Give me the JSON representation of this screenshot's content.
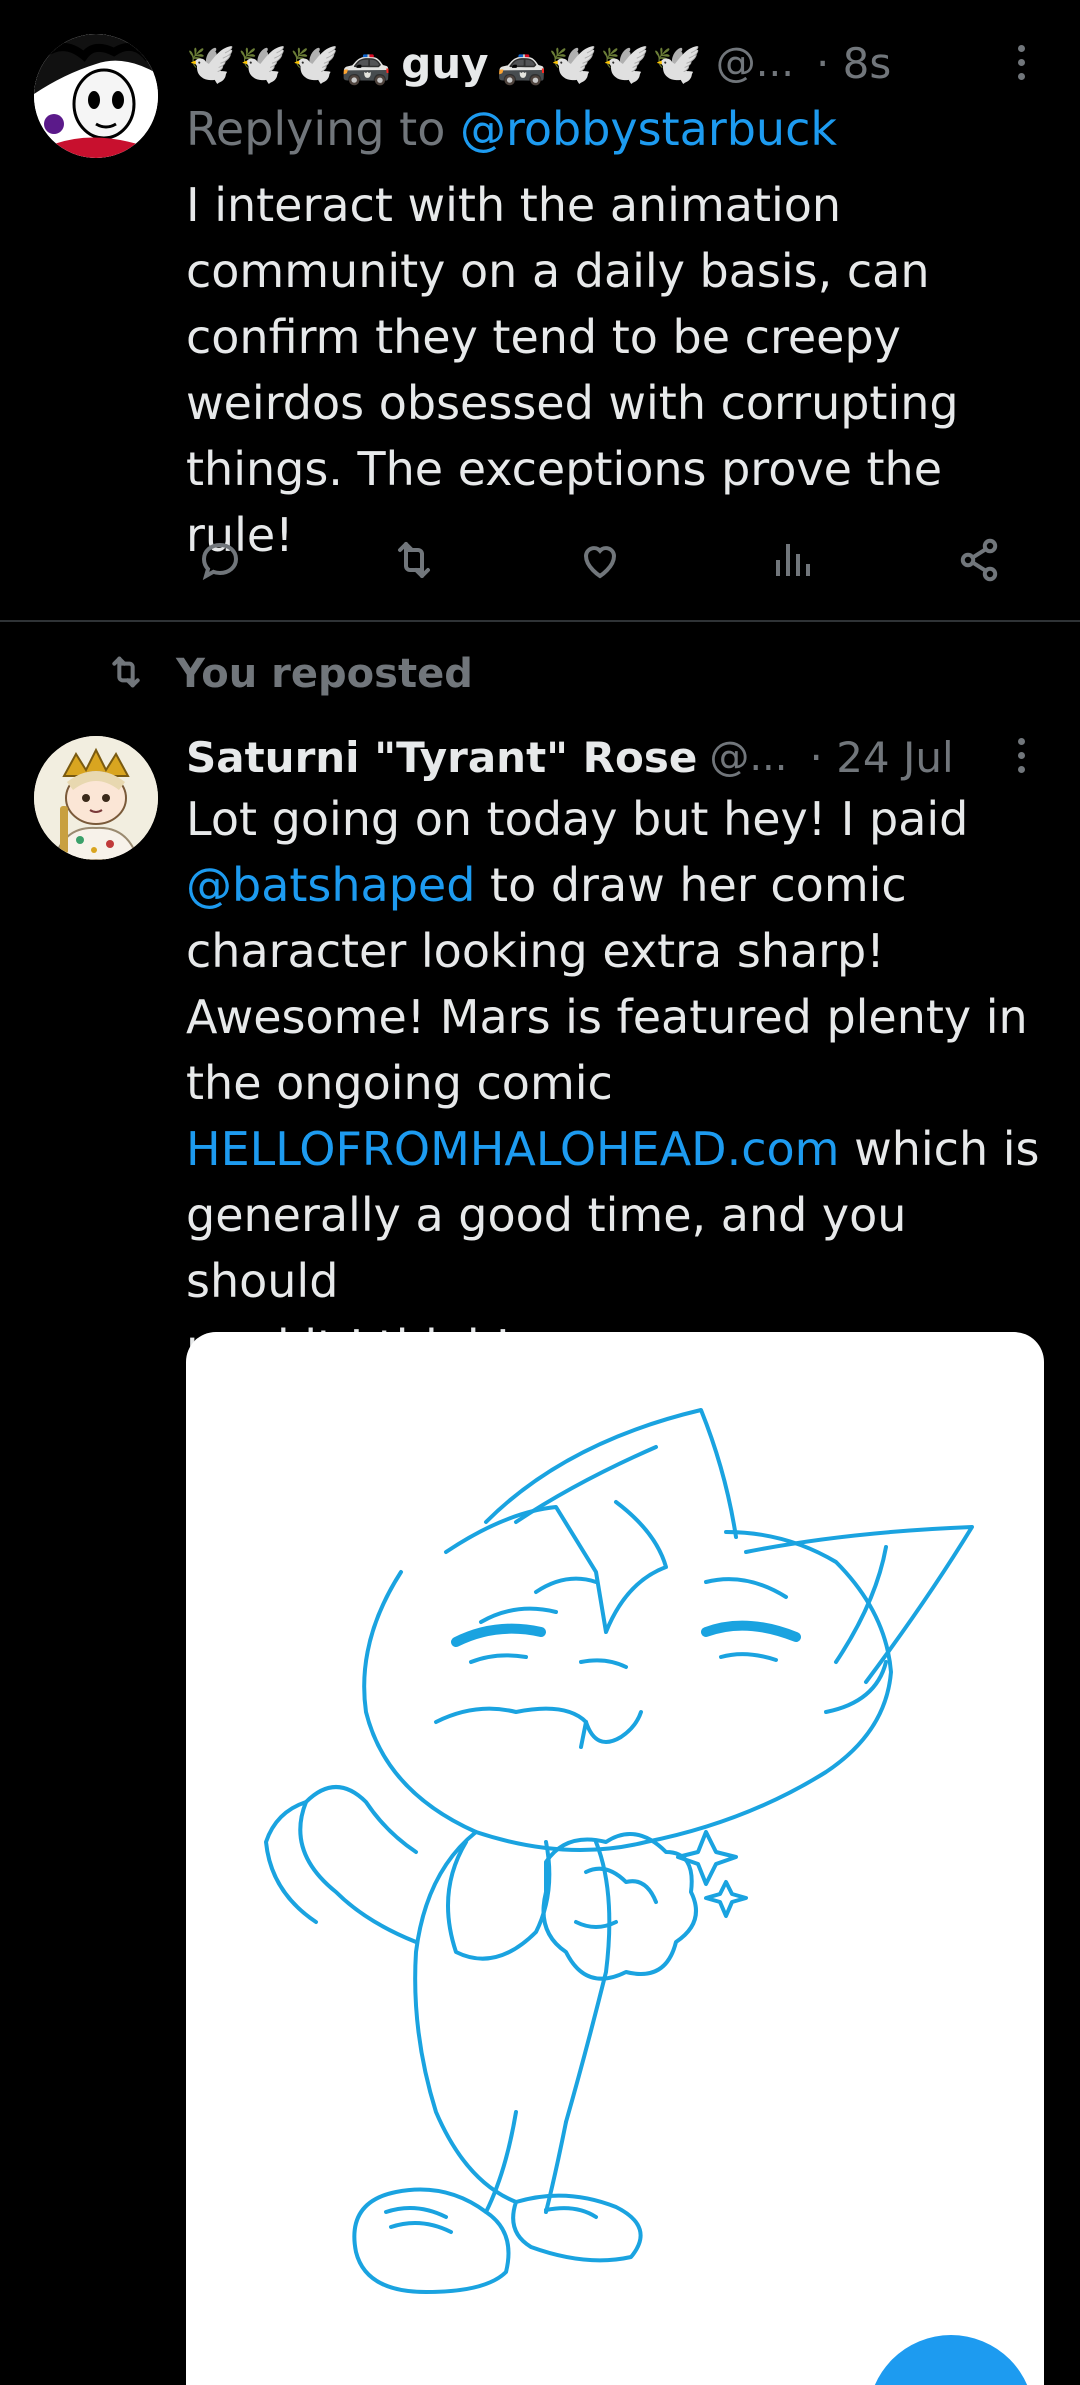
{
  "tweet1": {
    "emoji_prefix": "🕊️🕊️🕊️🚓",
    "display_name": "guy",
    "emoji_suffix": "🚓🕊️🕊️🕊️",
    "handle": "@...",
    "time": "· 8s",
    "replying_prefix": "Replying to ",
    "replying_handle": "@robbystarbuck",
    "text": "I interact with the animation\ncommunity on a daily basis, can\nconfirm they tend to be creepy\nweirdos obsessed with corrupting\nthings. The exceptions prove the rule!",
    "actions": [
      "reply-icon",
      "repost-icon",
      "like-icon",
      "views-icon",
      "share-icon"
    ]
  },
  "repost_banner": {
    "label": "You reposted",
    "icon": "repost-icon"
  },
  "tweet2": {
    "display_name": "Saturni \"Tyrant\" Rose",
    "handle": "@...",
    "time": "· 24 Jul",
    "text_part1": "Lot going on today but hey! I paid\n",
    "mention": "@batshaped",
    "text_part2": " to draw her comic\ncharacter looking extra sharp!\nAwesome! Mars is featured plenty in\nthe ongoing comic\n",
    "link": "HELLOFROMHALOHEAD.com",
    "text_part3": " which is\ngenerally a good time, and you should\nread it I think!",
    "media": "cat-character-line-drawing"
  },
  "colors": {
    "background": "#000000",
    "text": "#e7e9ea",
    "muted": "#71767b",
    "accent": "#1d9bf0",
    "divider": "#2f3336",
    "drawing": "#1aa3e0"
  }
}
